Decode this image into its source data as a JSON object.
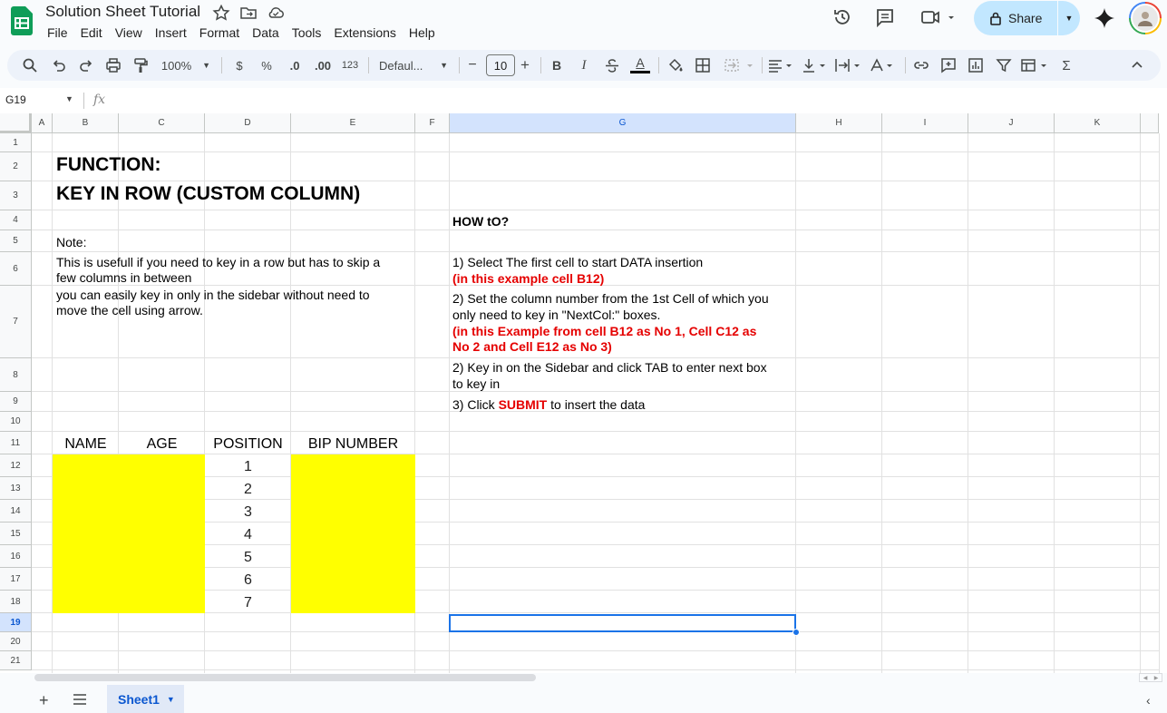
{
  "titlebar": {
    "doc_title": "Solution Sheet Tutorial",
    "share_label": "Share",
    "menu": [
      "File",
      "Edit",
      "View",
      "Insert",
      "Format",
      "Data",
      "Tools",
      "Extensions",
      "Help"
    ]
  },
  "toolbar": {
    "zoom": "100%",
    "currency": "$",
    "percent": "%",
    "dec_decrease": ".0",
    "dec_increase": ".00",
    "number_format": "123",
    "font": "Defaul...",
    "font_size": "10",
    "minus": "−",
    "plus": "+",
    "bold": "B",
    "italic": "I",
    "text_color": "A",
    "sum": "Σ"
  },
  "formulabar": {
    "cell_ref": "G19",
    "fx": "fx"
  },
  "grid": {
    "columns": [
      "A",
      "B",
      "C",
      "D",
      "E",
      "F",
      "G",
      "H",
      "I",
      "J",
      "K"
    ],
    "selected_column": "G",
    "rows": [
      "1",
      "2",
      "3",
      "4",
      "5",
      "6",
      "7",
      "8",
      "9",
      "10",
      "11",
      "12",
      "13",
      "14",
      "15",
      "16",
      "17",
      "18",
      "19",
      "20",
      "21"
    ],
    "selected_row": "19"
  },
  "content": {
    "function_title": "FUNCTION:",
    "function_name": "KEY IN ROW (CUSTOM COLUMN)",
    "note_label": "Note:",
    "note_line1": "This is usefull if you need to key in a row but has to skip a",
    "note_line2": "few columns in between",
    "note_line3": "you can easily key in only in the sidebar without need to",
    "note_line4": "move the cell using arrow.",
    "howto_title": "HOW tO?",
    "step1": "1) Select The first cell to start DATA insertion",
    "step1_example": "(in this example cell B12)",
    "step2_line1": "2) Set the column number from the 1st Cell of which you",
    "step2_line2": "only need to key in  \"NextCol:\" boxes.",
    "step2_example1": "(in this Example from cell B12 as No 1, Cell C12 as",
    "step2_example2": "No 2 and Cell E12 as No 3)",
    "step3_line1": "2) Key in on the Sidebar and click TAB to enter next box",
    "step3_line2": "to key in",
    "step4_prefix": "3) Click ",
    "step4_submit": "SUBMIT",
    "step4_suffix": " to insert the data"
  },
  "table": {
    "headers": [
      "NAME",
      "AGE",
      "POSITION",
      "BIP NUMBER"
    ],
    "positions": [
      "1",
      "2",
      "3",
      "4",
      "5",
      "6",
      "7"
    ]
  },
  "sheets": {
    "active": "Sheet1"
  },
  "colors": {
    "highlight": "#ffff00",
    "emphasis": "#e50000",
    "selection": "#1a73e8",
    "share_bg": "#c2e7ff"
  }
}
